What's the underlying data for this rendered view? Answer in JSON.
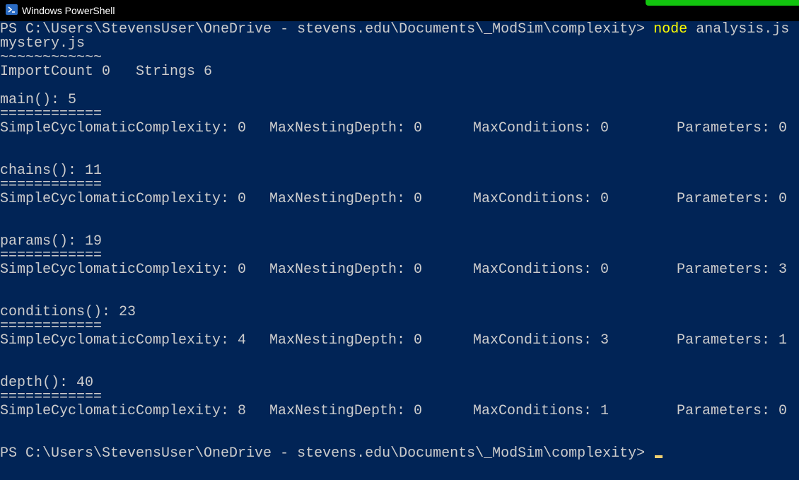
{
  "window": {
    "title": "Windows PowerShell"
  },
  "colors": {
    "console_bg": "#012456",
    "text": "#cccccc",
    "command": "#ffff00",
    "accent_green": "#12c40f"
  },
  "console": {
    "prompt": "PS C:\\Users\\StevensUser\\OneDrive - stevens.edu\\Documents\\_ModSim\\complexity>",
    "command_name": "node",
    "command_args": "analysis.js",
    "command_wrap": "mystery.js",
    "tilde_line": "~~~~~~~~~~~~",
    "import_line": "ImportCount 0   Strings 6",
    "separator": "============",
    "functions": [
      {
        "header": "main(): 5",
        "scc": "SimpleCyclomaticComplexity: 0",
        "depth": "MaxNestingDepth: 0",
        "cond": "MaxConditions: 0",
        "params": "Parameters: 0"
      },
      {
        "header": "chains(): 11",
        "scc": "SimpleCyclomaticComplexity: 0",
        "depth": "MaxNestingDepth: 0",
        "cond": "MaxConditions: 0",
        "params": "Parameters: 0"
      },
      {
        "header": "params(): 19",
        "scc": "SimpleCyclomaticComplexity: 0",
        "depth": "MaxNestingDepth: 0",
        "cond": "MaxConditions: 0",
        "params": "Parameters: 3"
      },
      {
        "header": "conditions(): 23",
        "scc": "SimpleCyclomaticComplexity: 4",
        "depth": "MaxNestingDepth: 0",
        "cond": "MaxConditions: 3",
        "params": "Parameters: 1"
      },
      {
        "header": "depth(): 40",
        "scc": "SimpleCyclomaticComplexity: 8",
        "depth": "MaxNestingDepth: 0",
        "cond": "MaxConditions: 1",
        "params": "Parameters: 0"
      }
    ],
    "final_prompt": "PS C:\\Users\\StevensUser\\OneDrive - stevens.edu\\Documents\\_ModSim\\complexity>"
  }
}
